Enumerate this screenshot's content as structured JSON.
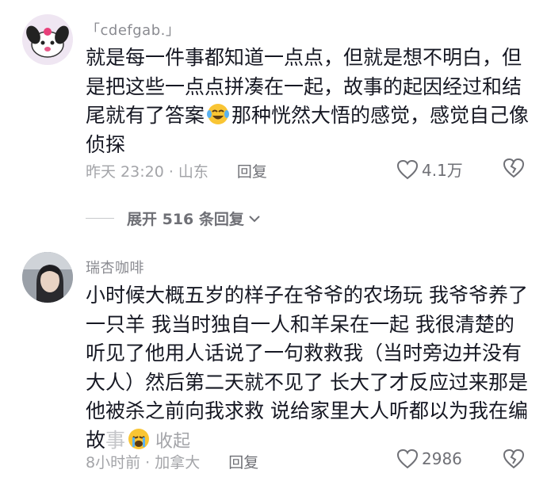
{
  "comments": [
    {
      "username": "「cdefgab.」",
      "text_part1": "就是每一件事都知道一点点，但就是想不明白，但是把这些一点点拼凑在一起，故事的起因经过和结尾就有了答案",
      "emoji_1": "face-with-tears-of-joy-icon",
      "text_part2": "那种恍然大悟的感觉，感觉自己像侦探",
      "time_location": "昨天 23:20 · 山东",
      "reply_label": "回复",
      "likes": "4.1万"
    },
    {
      "username": "瑞杏咖啡",
      "text_part1": "小时候大概五岁的样子在爷爷的农场玩 我爷爷养了一只羊 我当时独自一人和羊呆在一起 我很清楚的听见了他用人话说了一句救救我（当时旁边并没有大人）然后第二天就不见了 长大了才反应过来那是他被杀之前向我求救 说给家里大人听都以为我在编故",
      "text_fade": "事",
      "emoji_2": "crying-face-icon",
      "collapse_label": "收起",
      "time_location": "8小时前 · 加拿大",
      "reply_label": "回复",
      "likes": "2986"
    }
  ],
  "expand_replies_label": "展开 516 条回复"
}
